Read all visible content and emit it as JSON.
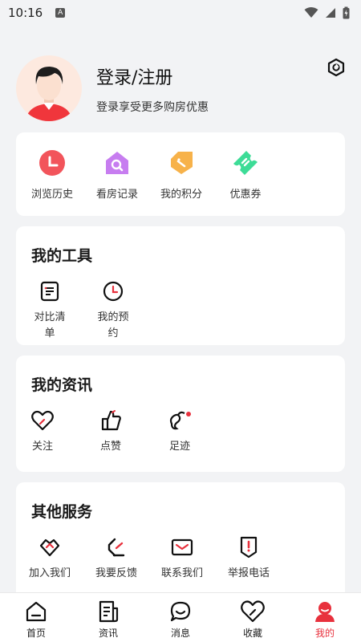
{
  "status_bar": {
    "time": "10:16",
    "notification_icon": "A"
  },
  "profile": {
    "title": "登录/注册",
    "subtitle": "登录享受更多购房优惠",
    "icons": {
      "avatar": "user-avatar",
      "settings": "hexagon-gear-icon"
    }
  },
  "quick_actions": [
    {
      "label": "浏览历史",
      "icon": "clock-icon",
      "color": "#f2545b"
    },
    {
      "label": "看房记录",
      "icon": "house-search-icon",
      "color": "#c77df0"
    },
    {
      "label": "我的积分",
      "icon": "tag-icon",
      "color": "#f7b24a"
    },
    {
      "label": "优惠券",
      "icon": "ticket-icon",
      "color": "#3ddc97"
    }
  ],
  "tools": {
    "title": "我的工具",
    "items": [
      {
        "label": "对比清单",
        "icon": "list-icon"
      },
      {
        "label": "我的预约",
        "icon": "clock-icon"
      }
    ]
  },
  "news": {
    "title": "我的资讯",
    "items": [
      {
        "label": "关注",
        "icon": "heart-icon"
      },
      {
        "label": "点赞",
        "icon": "thumbs-up-icon"
      },
      {
        "label": "足迹",
        "icon": "footprint-icon"
      }
    ]
  },
  "services": {
    "title": "其他服务",
    "items": [
      {
        "label": "加入我们",
        "icon": "handshake-icon"
      },
      {
        "label": "我要反馈",
        "icon": "feedback-icon"
      },
      {
        "label": "联系我们",
        "icon": "mail-icon"
      },
      {
        "label": "举报电话",
        "icon": "report-icon"
      }
    ]
  },
  "bottom_nav": [
    {
      "label": "首页",
      "icon": "home-icon",
      "active": false
    },
    {
      "label": "资讯",
      "icon": "news-icon",
      "active": false
    },
    {
      "label": "消息",
      "icon": "message-icon",
      "active": false
    },
    {
      "label": "收藏",
      "icon": "heart-icon",
      "active": false
    },
    {
      "label": "我的",
      "icon": "user-icon",
      "active": true
    }
  ],
  "colors": {
    "accent": "#e8313d",
    "background": "#f2f3f5",
    "card": "#ffffff"
  }
}
